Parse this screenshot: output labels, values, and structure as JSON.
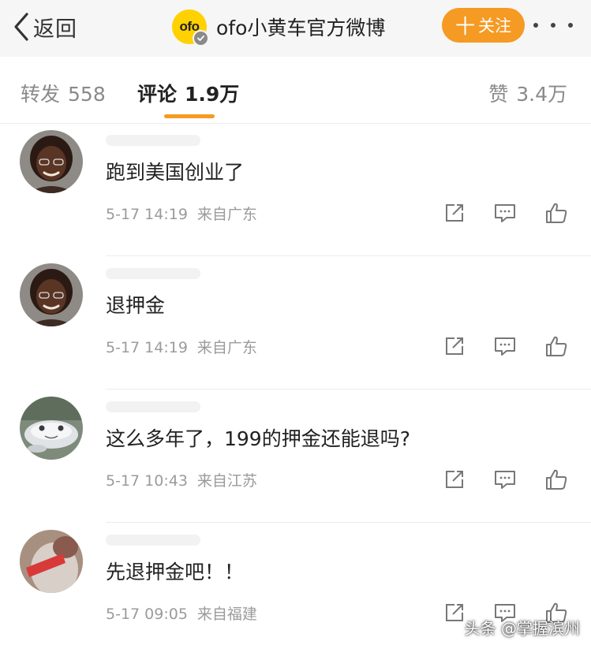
{
  "nav": {
    "back_label": "返回",
    "logo_text": "ofo",
    "title": "ofo小黄车官方微博",
    "follow_label": "关注",
    "follow_plus": "十",
    "accent_color": "#f59a23",
    "logo_color": "#ffd100"
  },
  "tabs": [
    {
      "label": "转发",
      "count": "558"
    },
    {
      "label": "评论",
      "count": "1.9万"
    },
    {
      "label": "赞",
      "count": "3.4万"
    }
  ],
  "comments": [
    {
      "text": "跑到美国创业了",
      "time": "5-17 14:19",
      "location": "来自广东",
      "avatar": "woman-glasses-avatar"
    },
    {
      "text": "退押金",
      "time": "5-17 14:19",
      "location": "来自广东",
      "avatar": "woman-glasses-avatar"
    },
    {
      "text": "这么多年了，199的押金还能退吗?",
      "time": "5-17 10:43",
      "location": "来自江苏",
      "avatar": "plush-toy-avatar"
    },
    {
      "text": "先退押金吧！！",
      "time": "5-17 09:05",
      "location": "来自福建",
      "avatar": "person-banner-avatar"
    }
  ],
  "icons": {
    "back": "chevron-left-icon",
    "more": "more-dots-icon",
    "share": "share-icon",
    "reply": "comment-icon",
    "like": "thumbs-up-icon"
  },
  "watermark": "头条 @掌握滨州"
}
